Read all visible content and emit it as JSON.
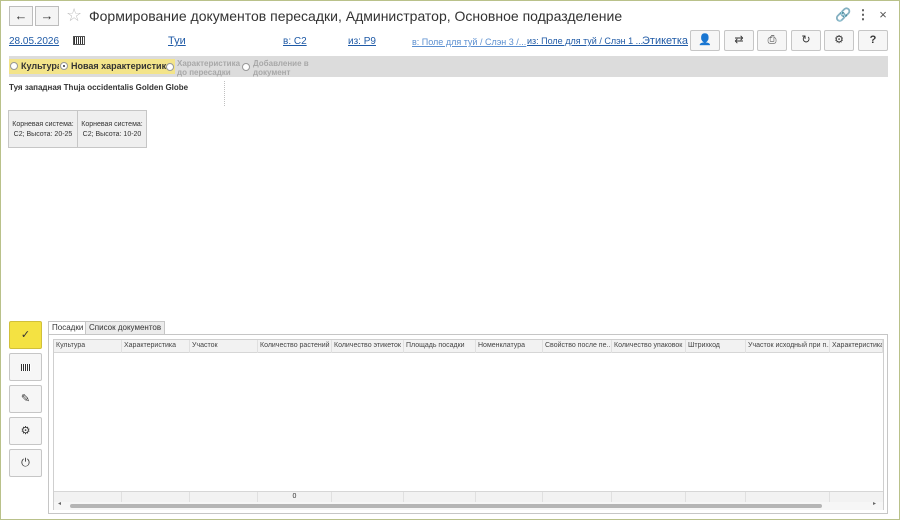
{
  "window": {
    "title": "Формирование документов пересадки, Администратор, Основное подразделение",
    "back_icon": "arrow-left-icon",
    "forward_icon": "arrow-right-icon",
    "favorite_icon": "star-icon",
    "link_icon": "link-icon",
    "more_icon": "more-vertical-icon",
    "close_icon": "close-icon"
  },
  "header": {
    "date": "28.05.2026",
    "culture": "Туи",
    "to_area": "в: С2",
    "from_area": "из: Р9",
    "to_field": "в: Поле для туй / Слэн 3 /...",
    "from_field": "из: Поле для туй / Слэн 1 ...",
    "label_link": "Этикетка"
  },
  "toolbar": {
    "user_icon": "user-icon",
    "transfer_icon": "transfer-icon",
    "print_icon": "print-icon",
    "refresh_icon": "refresh-icon",
    "settings_icon": "gear-icon",
    "help_label": "?"
  },
  "modes": {
    "culture": "Культура",
    "new_characteristic": "Новая характеристика",
    "char_before": "Характеристика до пересадки",
    "add_to_doc": "Добавление в документ"
  },
  "cultivar": "Туя западная Thuja occidentalis Golden Globe",
  "characteristics": [
    {
      "line1": "Корневая система:",
      "line2": "С2; Высота: 20-25"
    },
    {
      "line1": "Корневая система:",
      "line2": "С2; Высота: 10-20"
    }
  ],
  "side_buttons": [
    "check-icon",
    "barcode-icon",
    "edit-document-icon",
    "gear-icon",
    "power-icon"
  ],
  "tabs": [
    "Посадки",
    "Список документов"
  ],
  "table": {
    "columns": [
      "Культура",
      "Характеристика",
      "Участок",
      "Количество растений",
      "Количество этикеток",
      "Площадь посадки",
      "Номенклатура",
      "Свойство после пе...",
      "Количество упаковок",
      "Штрихкод",
      "Участок исходный при п...",
      "Характеристика"
    ],
    "total_plants": "0"
  },
  "colors": {
    "accent_yellow": "#f4e242",
    "link_blue": "#1f5aa6",
    "frame_border": "#b9c18a"
  }
}
